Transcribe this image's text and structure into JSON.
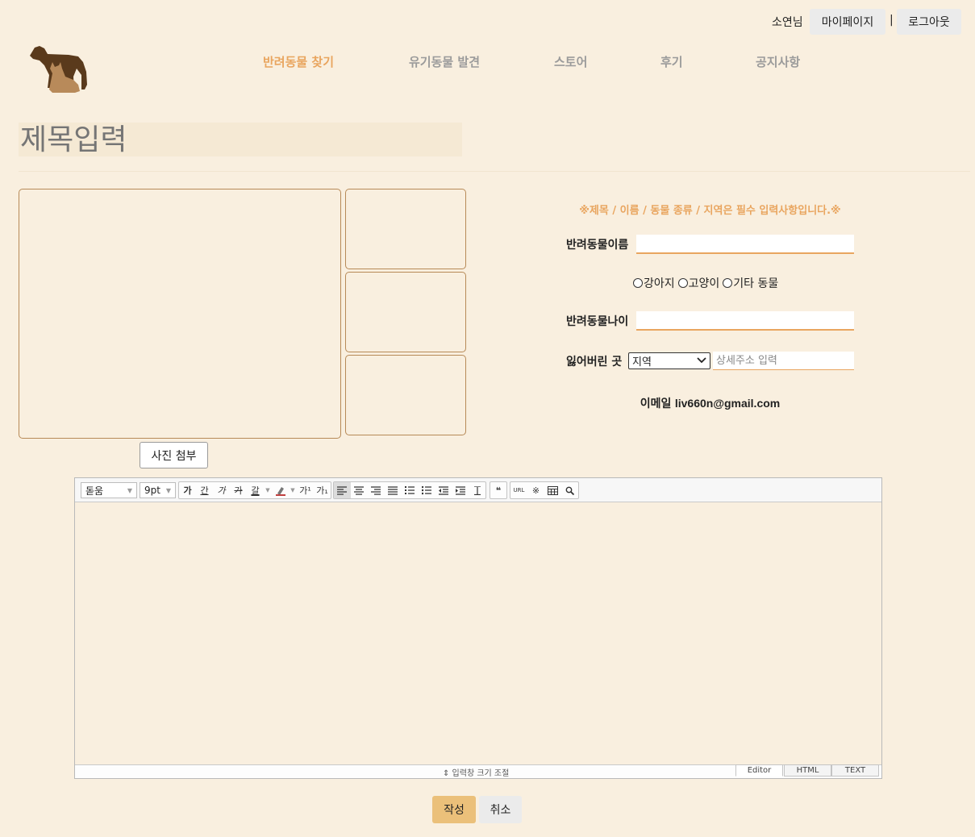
{
  "account": {
    "user_name": "소연님",
    "mypage_label": "마이페이지",
    "divider": "|",
    "logout_label": "로그아웃"
  },
  "nav": {
    "items": [
      {
        "label": "반려동물 찾기",
        "active": true
      },
      {
        "label": "유기동물 발견",
        "active": false
      },
      {
        "label": "스토어",
        "active": false
      },
      {
        "label": "후기",
        "active": false
      },
      {
        "label": "공지사항",
        "active": false
      }
    ]
  },
  "title_field": {
    "placeholder": "제목입력"
  },
  "photos": {
    "attach_label": "사진 첨부"
  },
  "form": {
    "notice": "※제목 / 이름 / 동물 종류 / 지역은 필수 입력사항입니다.※",
    "pet_name_label": "반려동물이름",
    "pet_name_value": "",
    "species_options": [
      "강아지",
      "고양이",
      "기타 동물"
    ],
    "pet_age_label": "반려동물나이",
    "pet_age_value": "",
    "lost_place_label": "잃어버린 곳",
    "region_selected": "지역",
    "address_placeholder": "상세주소 입력",
    "email_label": "이메일",
    "email_value": "liv660n@gmail.com"
  },
  "editor": {
    "font_family": "돋움",
    "font_size": "9pt",
    "format_buttons": [
      "가",
      "간",
      "가",
      "가",
      "갈"
    ],
    "sup_label": "가¹",
    "sub_label": "가₁",
    "quote_label": "❝",
    "url_label": "URL",
    "resize_label": "⇕ 입력창 크기 조절",
    "modes": [
      "Editor",
      "HTML",
      "TEXT"
    ],
    "active_mode": "Editor"
  },
  "actions": {
    "submit_label": "작성",
    "cancel_label": "취소"
  },
  "colors": {
    "background": "#f9efdf",
    "accent": "#e9a55f",
    "submit": "#ebc07a"
  }
}
